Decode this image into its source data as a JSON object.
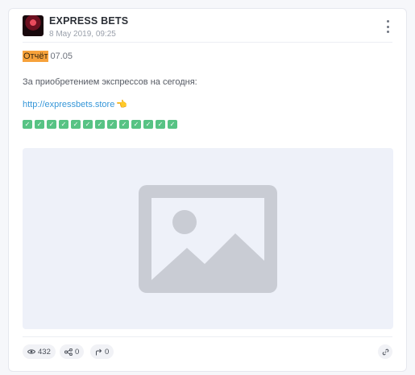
{
  "post": {
    "channel_name": "EXPRESS BETS",
    "date": "8 May 2019, 09:25",
    "report_word": "Отчёт",
    "report_date": "07.05",
    "text_line": "За приобретением экспрессов на сегодня:",
    "link": "http://expressbets.store",
    "link_emoji": "👈",
    "check_count": 13,
    "check_glyph": "✓"
  },
  "footer": {
    "views": "432",
    "shares": "0",
    "forwards": "0"
  },
  "icons": {
    "avatar": "channel-avatar",
    "menu": "vertical-dots-icon",
    "views": "eye-icon",
    "shares": "share-nodes-icon",
    "forwards": "forward-arrow-icon",
    "link": "link-icon",
    "media": "image-placeholder-icon"
  },
  "colors": {
    "highlight": "#f7a23b",
    "link": "#3596d8",
    "check": "#57c384",
    "media_bg": "#eef1f9",
    "placeholder": "#c9ccd4"
  }
}
